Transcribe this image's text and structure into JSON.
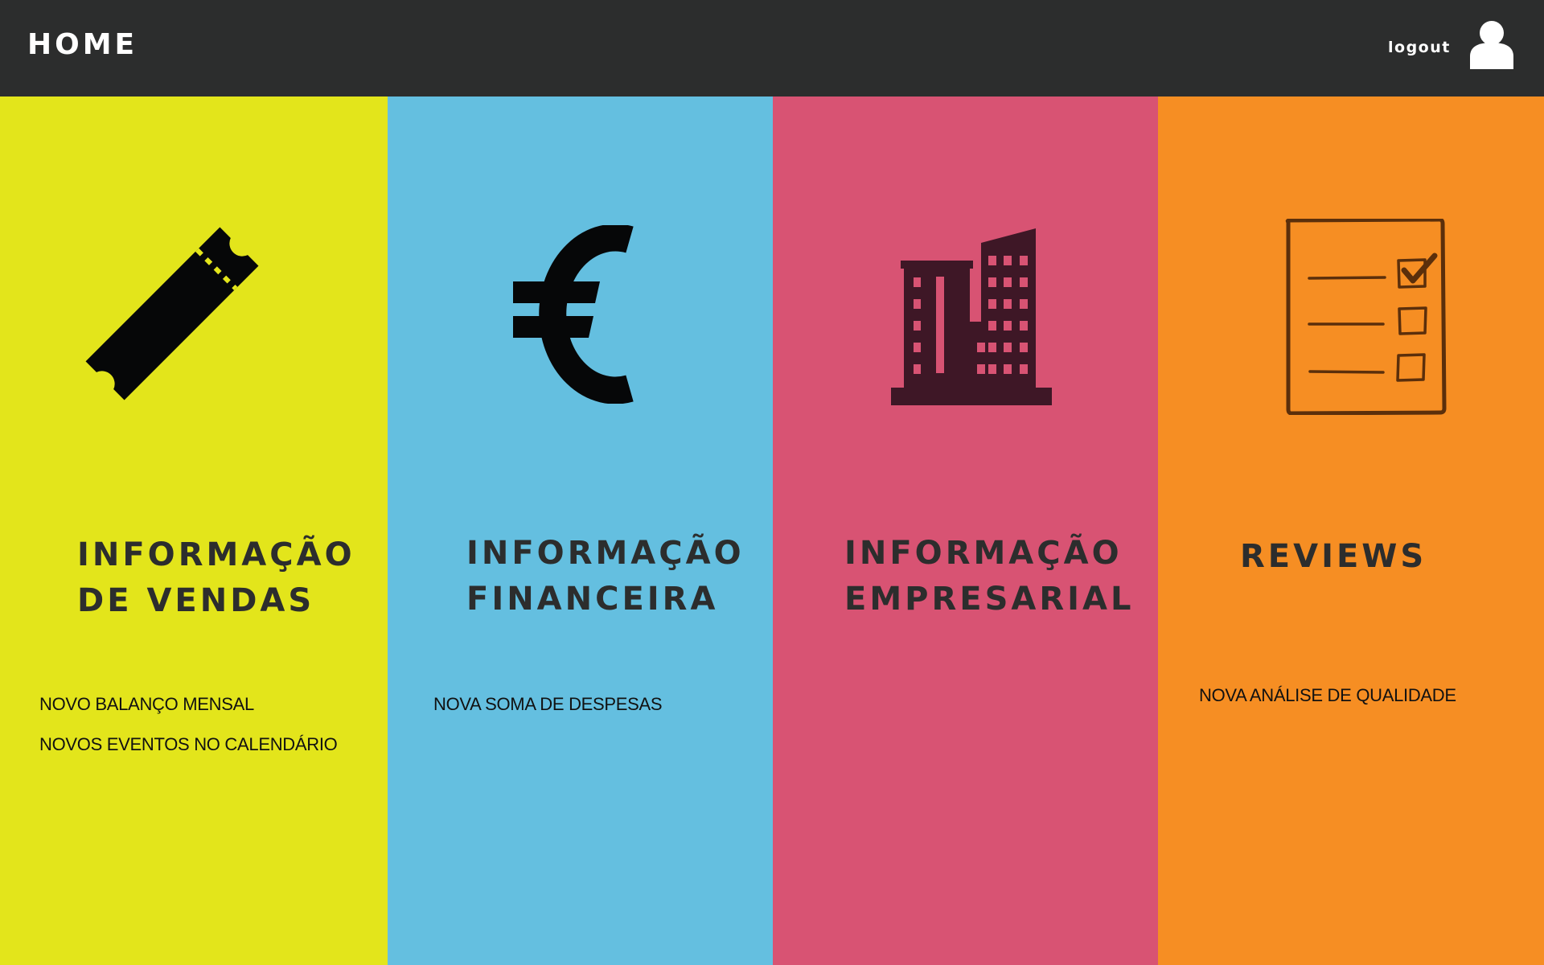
{
  "header": {
    "title": "HOME",
    "logout_label": "logout",
    "background": "#2c2d2d"
  },
  "panels": [
    {
      "title_lines": [
        "INFORMAÇÃO",
        "DE VENDAS"
      ],
      "icon": "ticket-icon",
      "color": "#e3e51b",
      "items": [
        "NOVO BALANÇO MENSAL",
        "NOVOS EVENTOS NO CALENDÁRIO"
      ]
    },
    {
      "title_lines": [
        "INFORMAÇÃO",
        "FINANCEIRA"
      ],
      "icon": "euro-icon",
      "color": "#64bfe0",
      "items": [
        "NOVA SOMA DE DESPESAS"
      ]
    },
    {
      "title_lines": [
        "INFORMAÇÃO",
        "EMPRESARIAL"
      ],
      "icon": "building-icon",
      "color": "#d85373",
      "items": []
    },
    {
      "title_lines": [
        "REVIEWS"
      ],
      "icon": "checklist-icon",
      "color": "#f68e23",
      "items": [
        "NOVA ANÁLISE DE QUALIDADE"
      ]
    }
  ]
}
